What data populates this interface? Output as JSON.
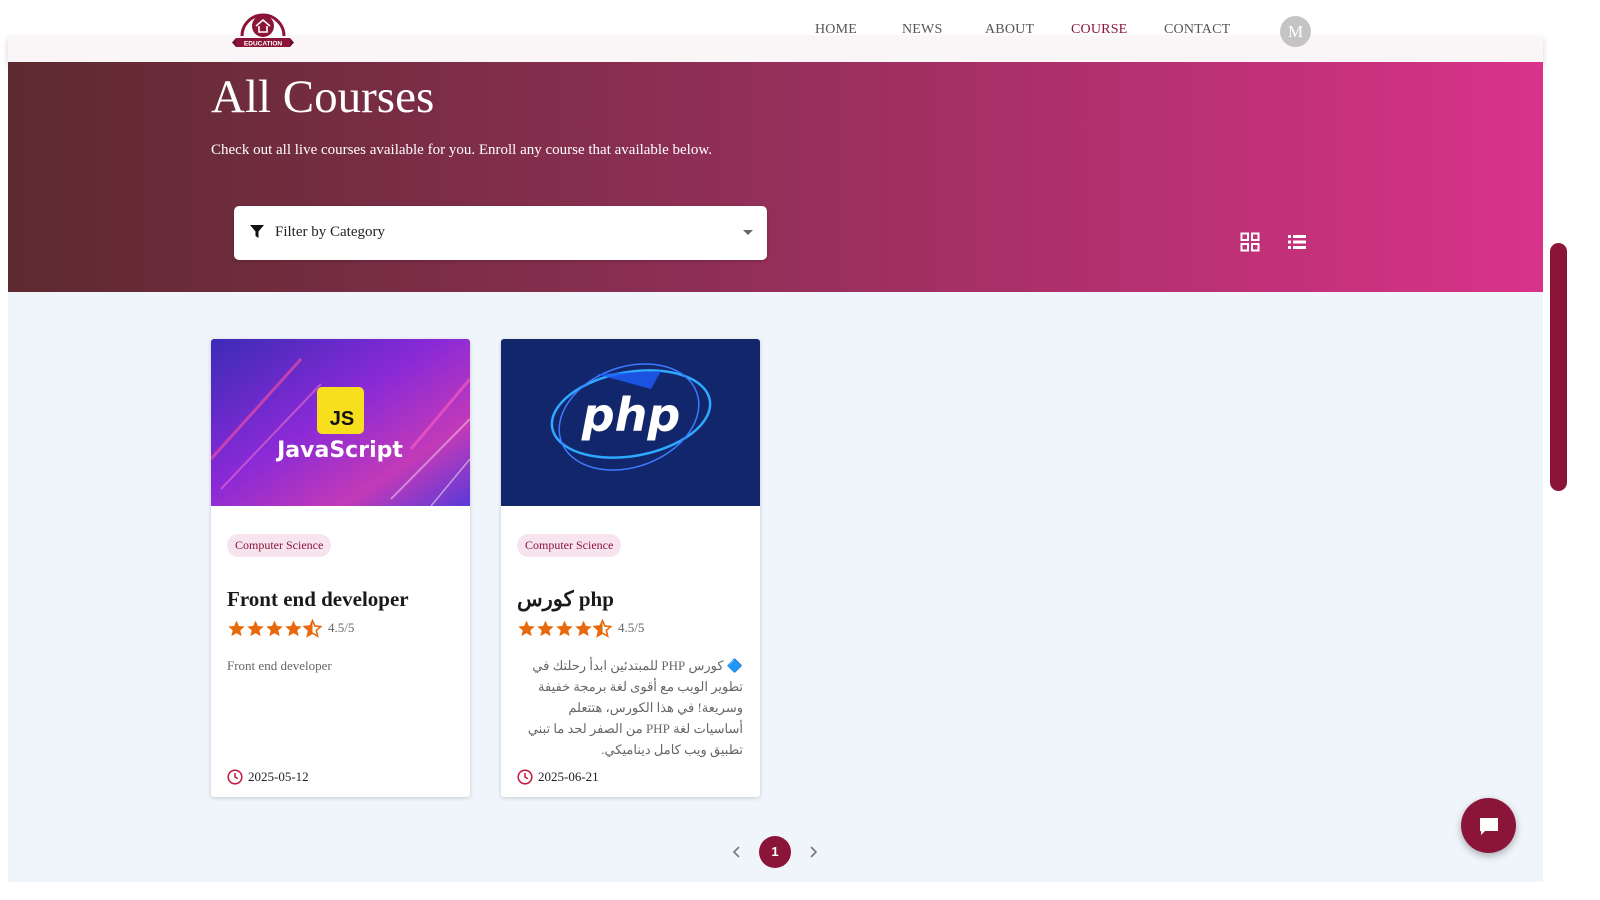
{
  "header": {
    "logo_text": "EDUCATION",
    "nav": [
      {
        "label": "HOME"
      },
      {
        "label": "NEWS"
      },
      {
        "label": "ABOUT"
      },
      {
        "label": "COURSE"
      },
      {
        "label": "CONTACT"
      }
    ],
    "active_nav": "COURSE",
    "avatar_initial": "M"
  },
  "hero": {
    "title": "All Courses",
    "subtitle": "Check out all live courses available for you. Enroll any course that available below.",
    "filter_label": "Filter by Category",
    "view_modes": [
      "grid-view",
      "list-view"
    ]
  },
  "courses": [
    {
      "image_text": "JavaScript",
      "image_badge": "JS",
      "category": "Computer Science",
      "title": "Front end developer",
      "rating": "4.5/5",
      "stars": 4.5,
      "description": "Front end developer",
      "date": "2025-05-12"
    },
    {
      "image_text": "php",
      "category": "Computer Science",
      "title": "كورس php",
      "rating": "4.5/5",
      "stars": 4.5,
      "description": "🔷 كورس PHP للمبتدئين ابدأ رحلتك في تطوير الويب مع أقوى لغة برمجة خفيفة وسريعة! في هذا الكورس، هتتعلم أساسيات لغة PHP من الصفر لحد ما تبني تطبيق ويب كامل ديناميكي.",
      "date": "2025-06-21"
    }
  ],
  "pagination": {
    "current_page": "1"
  },
  "colors": {
    "brand": "#8b1538",
    "hero_start": "#5e2a2f",
    "hero_end": "#d9328a",
    "star": "#e8690c",
    "content_bg": "#f0f5fc"
  }
}
